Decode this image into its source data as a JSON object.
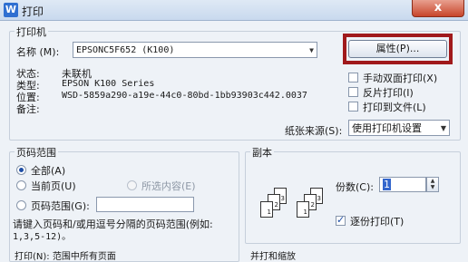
{
  "window": {
    "title": "打印",
    "app_icon_letter": "W",
    "close_symbol": "x"
  },
  "printer_group": {
    "title": "打印机",
    "name_label": "名称 (M):",
    "name_value": "EPSONC5F652 (K100)",
    "properties_button": "属性(P)...",
    "status_label": "状态:",
    "status_value": "未联机",
    "type_label": "类型:",
    "type_value": "EPSON K100 Series",
    "location_label": "位置:",
    "location_value": "WSD-5859a290-a19e-44c0-80bd-1bb93903c442.0037",
    "comment_label": "备注:",
    "duplex_label": "手动双面打印(X)",
    "reverse_label": "反片打印(I)",
    "to_file_label": "打印到文件(L)",
    "paper_source_label": "纸张来源(S):",
    "paper_source_value": "使用打印机设置"
  },
  "page_range": {
    "title": "页码范围",
    "all_label": "全部(A)",
    "current_label": "当前页(U)",
    "selection_label": "所选内容(E)",
    "pages_label": "页码范围(G):",
    "pages_value": "",
    "hint_line1": "请键入页码和/或用逗号分隔的页码范围(例如:",
    "hint_line2": "1,3,5-12)。",
    "bottom_partial": "打印(N): 范围中所有页面"
  },
  "copies": {
    "title": "副本",
    "copies_label": "份数(C):",
    "copies_value": "1",
    "collate_label": "逐份打印(T)",
    "icon_pages": [
      "1",
      "2",
      "3"
    ],
    "bottom_partial": "并打和缩放"
  }
}
